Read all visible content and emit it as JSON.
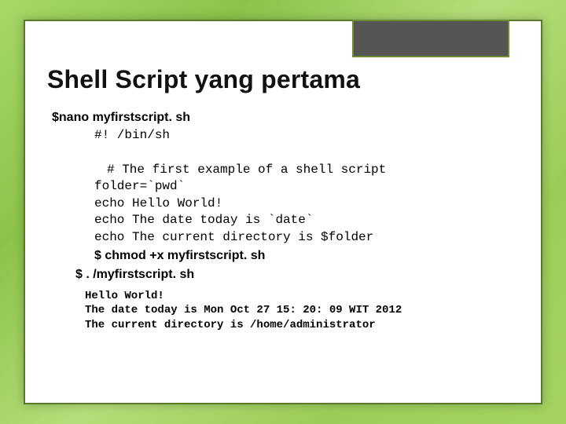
{
  "title": "Shell Script yang pertama",
  "cmd_nano": "$nano myfirstscript. sh",
  "script": {
    "shebang": "#! /bin/sh",
    "comment": "# The first example of a shell script",
    "l1": "folder=`pwd`",
    "l2": "echo Hello World!",
    "l3": "echo The date today is `date`",
    "l4": "echo The current directory is $folder"
  },
  "cmd_chmod": "$ chmod +x myfirstscript. sh",
  "cmd_run": "$ . /myfirstscript. sh",
  "output": {
    "o1": "Hello World!",
    "o2": "The date today is Mon Oct 27 15: 20: 09 WIT 2012",
    "o3": "The current directory is /home/administrator"
  }
}
